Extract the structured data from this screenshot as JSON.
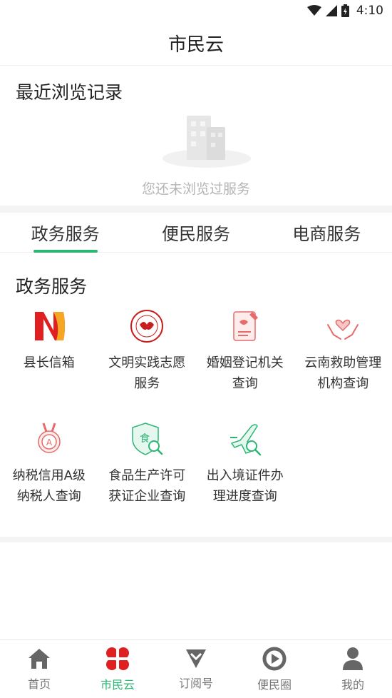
{
  "status": {
    "time": "4:10"
  },
  "header": {
    "title": "市民云"
  },
  "recent": {
    "heading": "最近浏览记录",
    "empty_text": "您还未浏览过服务"
  },
  "tabs": [
    {
      "label": "政务服务",
      "active": true
    },
    {
      "label": "便民服务",
      "active": false
    },
    {
      "label": "电商服务",
      "active": false
    }
  ],
  "section": {
    "heading": "政务服务",
    "items": [
      {
        "label": "县长信箱",
        "icon": "county-mailbox-logo-icon"
      },
      {
        "label": "文明实践志愿服务",
        "icon": "volunteer-seal-icon"
      },
      {
        "label": "婚姻登记机关查询",
        "icon": "marriage-registration-icon"
      },
      {
        "label": "云南救助管理机构查询",
        "icon": "rescue-hands-heart-icon"
      },
      {
        "label": "纳税信用A级纳税人查询",
        "icon": "tax-credit-medal-icon"
      },
      {
        "label": "食品生产许可获证企业查询",
        "icon": "food-license-shield-icon"
      },
      {
        "label": "出入境证件办理进度查询",
        "icon": "airplane-search-icon"
      }
    ]
  },
  "nav": [
    {
      "label": "首页",
      "icon": "home-icon",
      "active": false
    },
    {
      "label": "市民云",
      "icon": "clover-icon",
      "active": true
    },
    {
      "label": "订阅号",
      "icon": "subscription-icon",
      "active": false
    },
    {
      "label": "便民圈",
      "icon": "circle-icon",
      "active": false
    },
    {
      "label": "我的",
      "icon": "person-icon",
      "active": false
    }
  ],
  "colors": {
    "accent": "#2bb673",
    "brand_red": "#e02020",
    "icon_gray": "#666666"
  }
}
